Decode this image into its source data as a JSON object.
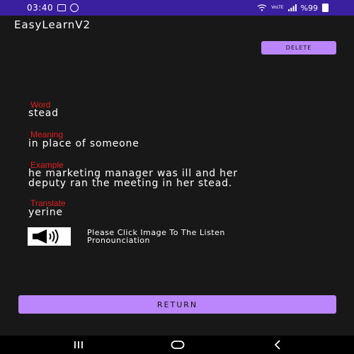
{
  "status_bar": {
    "time": "03:40",
    "network": "VoLTE",
    "battery": "%99"
  },
  "app": {
    "title": "EasyLearnV2"
  },
  "toolbar": {
    "delete_label": "DELETE"
  },
  "fields": {
    "word_label": "Word",
    "word_value": "stead",
    "meaning_label": "Meaning",
    "meaning_value": "in place of someone",
    "example_label": "Example",
    "example_value_line1": "he marketing manager was ill and her",
    "example_value_line2": "deputy ran the meeting in her stead.",
    "translate_label": "Translate",
    "translate_value": "yerine"
  },
  "audio": {
    "icon": "speaker-icon",
    "hint_line1": "Please Click Image To The Listen",
    "hint_line2": "Pronounciation"
  },
  "actions": {
    "return_label": "RETURN"
  },
  "navigation": {
    "recents_icon": "recents-icon",
    "home_icon": "home-icon",
    "back_icon": "back-icon"
  },
  "colors": {
    "status_bar": "#3a1f9e",
    "background": "#181818",
    "accent": "#bb86fc",
    "label": "#e02020"
  }
}
